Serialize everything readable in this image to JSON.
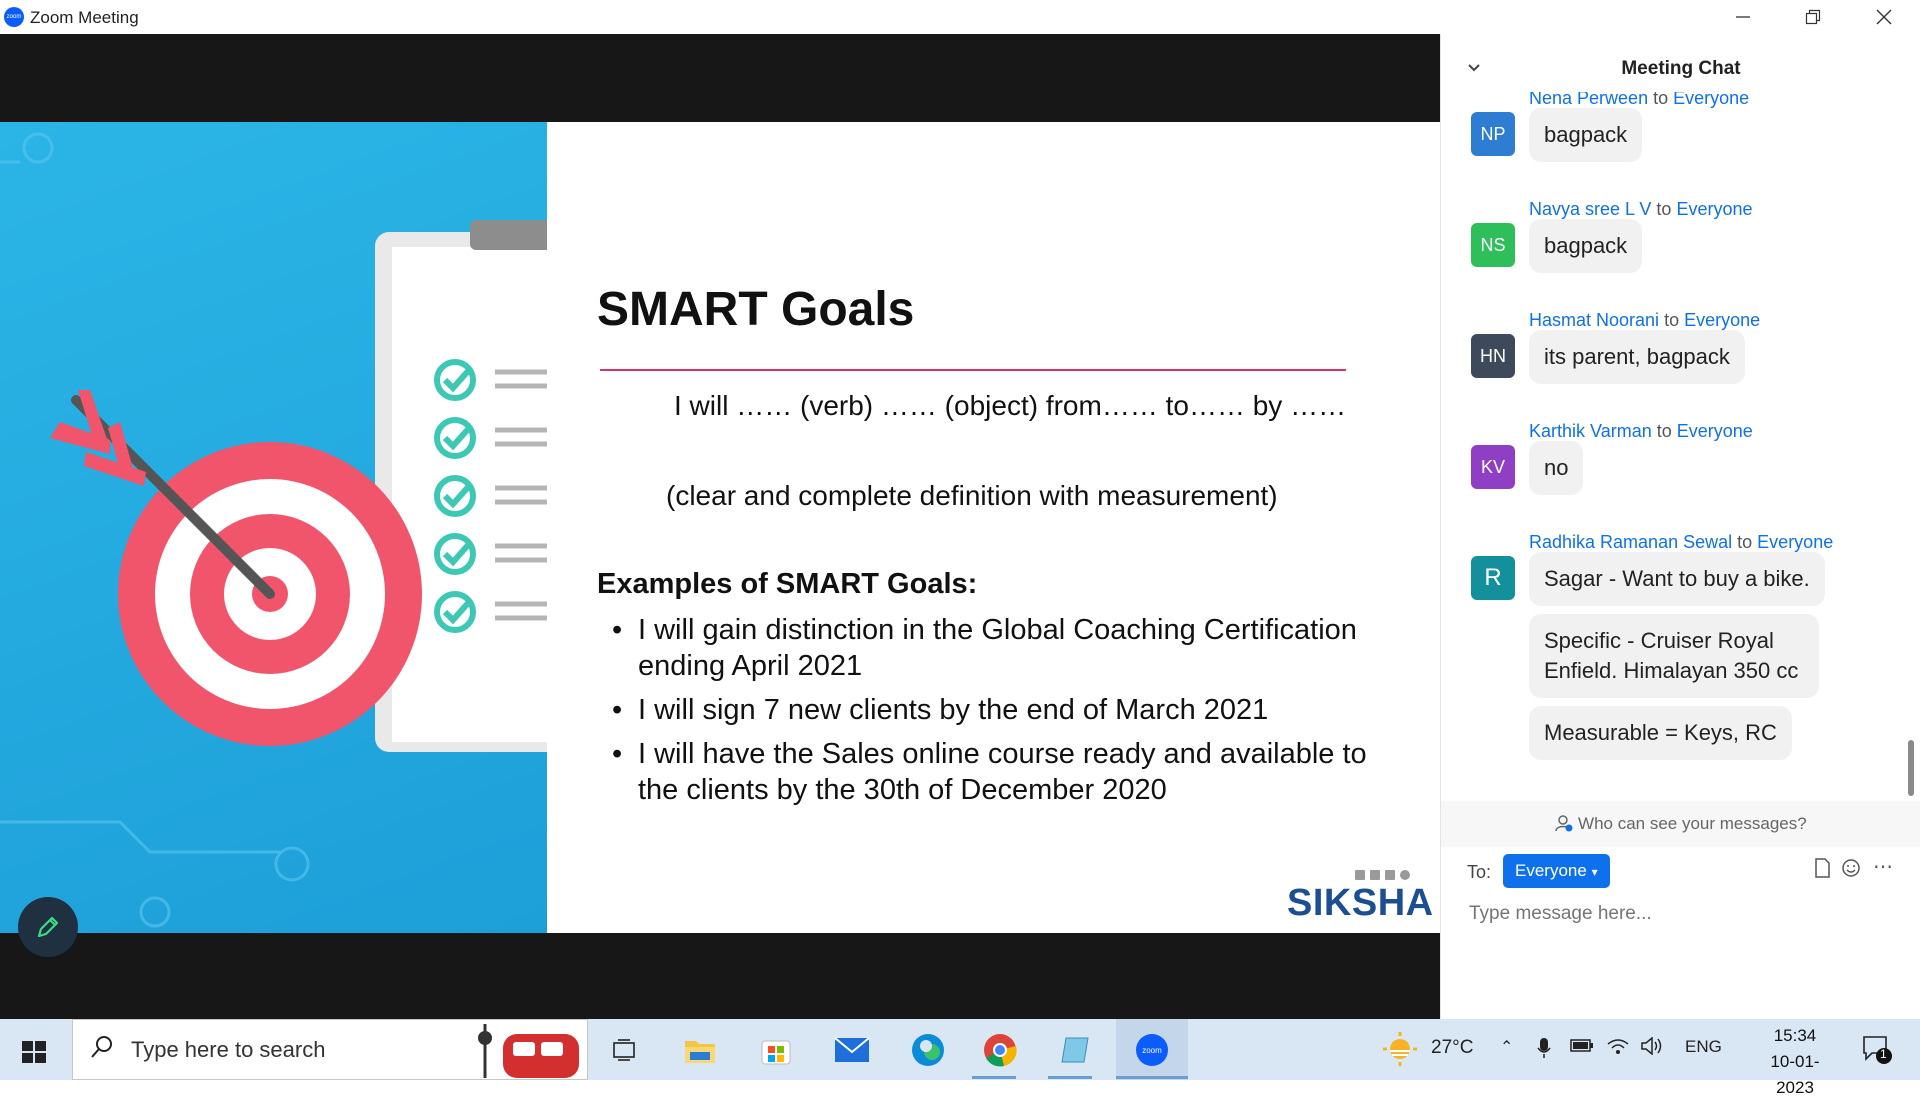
{
  "window": {
    "title": "Zoom Meeting",
    "app_icon": "zoom-icon"
  },
  "slide": {
    "title": "SMART Goals",
    "formula": "I will …… (verb) …… (object) from…… to…… by ……",
    "clarifier": "(clear and complete definition with measurement)",
    "examples_heading": "Examples of SMART Goals:",
    "bullets": [
      "I will gain distinction in the Global Coaching Certification ending April 2021",
      "I will sign 7 new clients by the end of March 2021",
      "I will have the Sales online course ready and available to the clients by the 30th of December 2020"
    ],
    "brand": "SIKSHA",
    "colors": {
      "left_panel": "#2bb5e6",
      "rule": "#d6336c",
      "brand": "#1c4f91"
    }
  },
  "chat": {
    "title": "Meeting Chat",
    "messages": [
      {
        "initials": "NP",
        "sender": "Nena Perween",
        "to": "to",
        "recipient": "Everyone",
        "text": "bagpack",
        "color": "#2d7dd2"
      },
      {
        "initials": "NS",
        "sender": "Navya sree L V",
        "to": "to",
        "recipient": "Everyone",
        "text": "bagpack",
        "color": "#2fbf5a"
      },
      {
        "initials": "HN",
        "sender": "Hasmat Noorani",
        "to": "to",
        "recipient": "Everyone",
        "text": "its parent, bagpack",
        "color": "#3c4a5c"
      },
      {
        "initials": "KV",
        "sender": "Karthik Varman",
        "to": "to",
        "recipient": "Everyone",
        "text": "no",
        "color": "#8e3fc4"
      },
      {
        "initials": "R",
        "sender": "Radhika Ramanan Sewal",
        "to": "to",
        "recipient": "Everyone",
        "texts": [
          "Sagar - Want to buy a bike.",
          "Specific  - Cruiser Royal Enfield. Himalayan 350 cc",
          "Measurable = Keys, RC"
        ],
        "color": "#13909b"
      }
    ],
    "who_can_see": "Who can see your messages?",
    "to_label": "To:",
    "recipient_button": "Everyone",
    "input_placeholder": "Type message here..."
  },
  "taskbar": {
    "search_placeholder": "Type here to search",
    "weather": "27°C",
    "language": "ENG",
    "time": "15:34",
    "date": "10-01-2023",
    "notification_count": "1"
  }
}
